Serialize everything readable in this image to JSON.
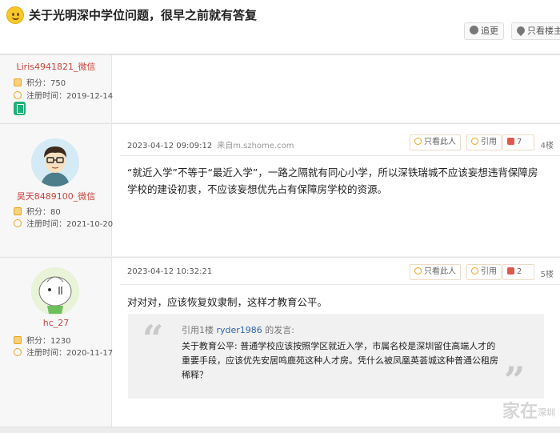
{
  "thread": {
    "title": "关于光明深中学位问题，很早之前就有答复",
    "follow_label": "追更",
    "only_op_label": "只看楼主"
  },
  "posts": [
    {
      "username": "Liris4941821_微信",
      "points_label": "积分：",
      "points": "750",
      "reg_label": "注册时间：",
      "reg_date": "2019-12-14"
    },
    {
      "username": "昊天8489100_微信",
      "points_label": "积分：",
      "points": "80",
      "reg_label": "注册时间：",
      "reg_date": "2021-10-20",
      "time": "2023-04-12 09:09:12",
      "source": "来自m.szhome.com",
      "only_this_label": "只看此人",
      "quote_label": "引用",
      "likes": "7",
      "floor": "4楼",
      "content": "“就近入学”不等于“最近入学”，一路之隔就有同心小学，所以深铁瑞城不应该妄想违背保障房学校的建设初衷，不应该妄想优先占有保障房学校的资源。"
    },
    {
      "username": "hc_27",
      "points_label": "积分：",
      "points": "1230",
      "reg_label": "注册时间：",
      "reg_date": "2020-11-17",
      "time": "2023-04-12 10:32:21",
      "only_this_label": "只看此人",
      "quote_label": "引用",
      "likes": "2",
      "floor": "5楼",
      "content": "对对对，应该恢复奴隶制，这样才教育公平。",
      "quote": {
        "prefix": "引用1楼 ",
        "user": "ryder1986",
        "suffix": " 的发言:",
        "text": "关于教育公平: 普通学校应该按照学区就近入学，市属名校是深圳留住高端人才的重要手段，应该优先安居鸣鹿苑这种人才房。凭什么被凤凰英荟城这种普通公租房稀释？"
      }
    }
  ],
  "watermark": {
    "main": "家在",
    "sub": "深圳"
  },
  "colors": {
    "username": "#c9463d",
    "accent": "#f0a31a",
    "link": "#3366aa"
  }
}
